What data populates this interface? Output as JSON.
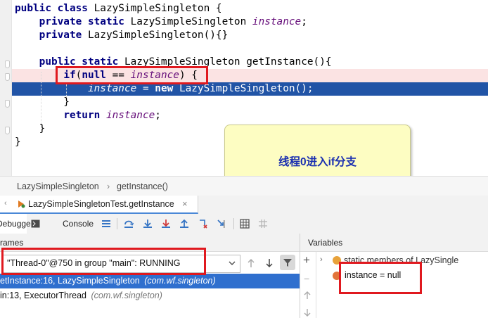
{
  "editor": {
    "lines": [
      {
        "parts": [
          [
            "kw",
            "public class "
          ],
          [
            "",
            "LazySimpleSingleton {"
          ]
        ]
      },
      {
        "parts": [
          [
            "",
            "    "
          ],
          [
            "kw",
            "private static "
          ],
          [
            "",
            "LazySimpleSingleton "
          ],
          [
            "fld",
            "instance"
          ],
          [
            "",
            ";"
          ]
        ]
      },
      {
        "parts": [
          [
            "",
            "    "
          ],
          [
            "kw",
            "private "
          ],
          [
            "",
            "LazySimpleSingleton(){}"
          ]
        ]
      },
      {
        "parts": [
          [
            "",
            ""
          ]
        ]
      },
      {
        "parts": [
          [
            "",
            "    "
          ],
          [
            "kw",
            "public static "
          ],
          [
            "",
            "LazySimpleSingleton getInstance(){"
          ]
        ]
      },
      {
        "parts": [
          [
            "",
            "        "
          ],
          [
            "kw",
            "if"
          ],
          [
            "",
            "("
          ],
          [
            "kw",
            "null"
          ],
          [
            "",
            " == "
          ],
          [
            "fld",
            "instance"
          ],
          [
            "",
            ") {"
          ]
        ]
      },
      {
        "parts": [
          [
            "",
            "            "
          ],
          [
            "fld",
            "instance"
          ],
          [
            "",
            " = "
          ],
          [
            "kw",
            "new "
          ],
          [
            "",
            "LazySimpleSingleton();"
          ]
        ]
      },
      {
        "parts": [
          [
            "",
            "        }"
          ]
        ]
      },
      {
        "parts": [
          [
            "",
            "        "
          ],
          [
            "kw",
            "return "
          ],
          [
            "fld",
            "instance"
          ],
          [
            "",
            ";"
          ]
        ]
      },
      {
        "parts": [
          [
            "",
            "    }"
          ]
        ]
      },
      {
        "parts": [
          [
            "",
            "}"
          ]
        ]
      }
    ]
  },
  "note": {
    "text": "线程0进入if分支"
  },
  "breadcrumb": {
    "class_name": "LazySimpleSingleton",
    "separator": "›",
    "method": "getInstance()"
  },
  "debug_tab": {
    "label": "LazySimpleSingletonTest.getInstance",
    "close": "×"
  },
  "toolbar": {
    "debugger_label": "Debugger",
    "console_label": "Console"
  },
  "frames": {
    "header": "rames",
    "thread_selector": "\"Thread-0\"@750 in group \"main\": RUNNING",
    "rows": [
      {
        "text": "etInstance:16, LazySimpleSingleton",
        "pkg": "(com.wf.singleton)"
      },
      {
        "text": "in:13, ExecutorThread",
        "pkg": "(com.wf.singleton)"
      }
    ]
  },
  "variables": {
    "header": "Variables",
    "static_row": "static members of LazySingle",
    "instance_row": "instance = null"
  },
  "colors": {
    "highlight_blue": "#2154a6",
    "highlight_red": "#fbe3e3",
    "annotation_red": "#e0191f",
    "note_bg": "#fdfdc2"
  }
}
